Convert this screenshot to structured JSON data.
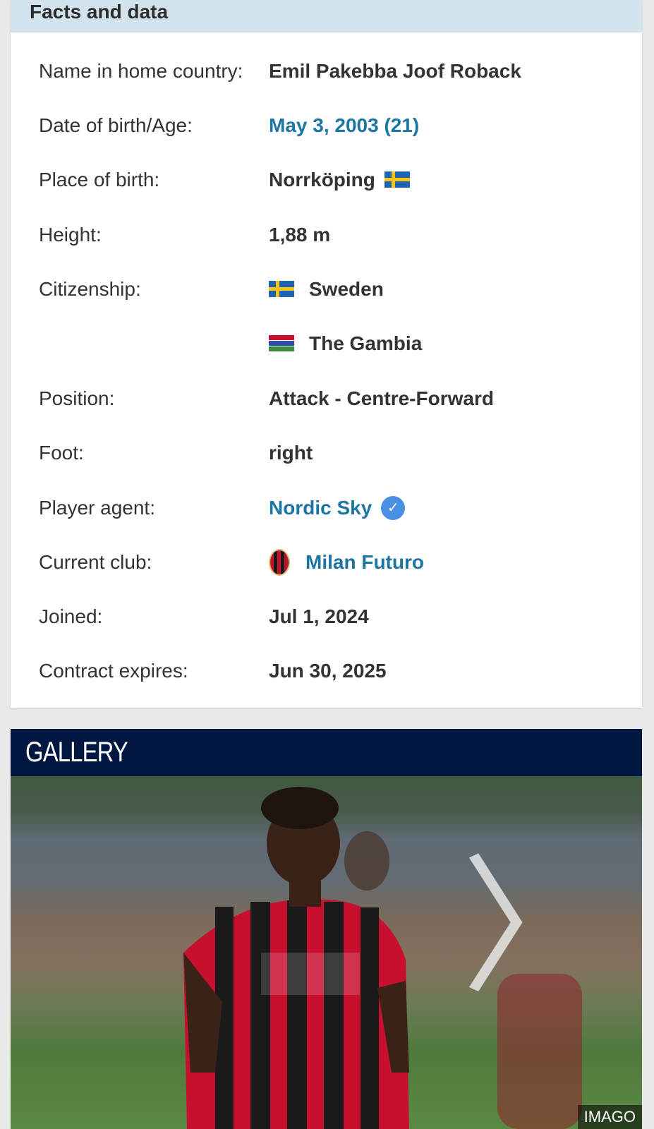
{
  "facts": {
    "title": "Facts and data",
    "rows": [
      {
        "label": "Name in home country:",
        "value": "Emil Pakebba Joof Roback"
      },
      {
        "label": "Date of birth/Age:",
        "value": "May 3, 2003 (21)"
      },
      {
        "label": "Place of birth:",
        "value": "Norrköping",
        "flag": "sweden-flag"
      },
      {
        "label": "Height:",
        "value": "1,88 m"
      },
      {
        "label": "Citizenship:",
        "value": "Sweden",
        "flag": "sweden-flag"
      },
      {
        "label": "",
        "value": "The Gambia",
        "flag": "gambia-flag"
      },
      {
        "label": "Position:",
        "value": "Attack - Centre-Forward"
      },
      {
        "label": "Foot:",
        "value": "right"
      },
      {
        "label": "Player agent:",
        "value": "Nordic Sky",
        "icon": "verified-check-icon"
      },
      {
        "label": "Current club:",
        "value": "Milan Futuro",
        "icon": "club-crest-icon"
      },
      {
        "label": "Joined:",
        "value": "Jul 1, 2024"
      },
      {
        "label": "Contract expires:",
        "value": "Jun 30, 2025"
      }
    ]
  },
  "gallery": {
    "title": "GALLERY",
    "credit": "IMAGO",
    "next_icon": "chevron-right-icon"
  },
  "colors": {
    "header_bg": "#d3e3ee",
    "link": "#1d75a3",
    "gallery_bg": "#001742"
  }
}
